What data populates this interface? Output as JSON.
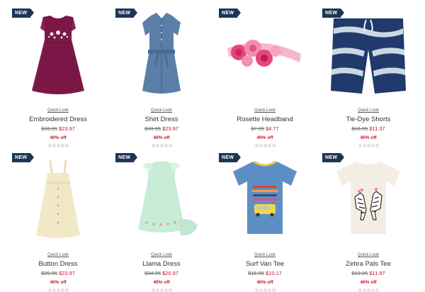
{
  "products": [
    {
      "badge": "NEW",
      "quick_look": "Quick Look",
      "name": "Embroidered Dress",
      "was": "$39.95",
      "now": "$23.97",
      "discount": "40% off",
      "icon": "embroidered-dress-image",
      "rating": 0
    },
    {
      "badge": "NEW",
      "quick_look": "Quick Look",
      "name": "Shirt Dress",
      "was": "$39.95",
      "now": "$23.97",
      "discount": "40% off",
      "icon": "shirt-dress-image",
      "rating": 0
    },
    {
      "badge": "NEW",
      "quick_look": "Quick Look",
      "name": "Rosette Headband",
      "was": "$7.95",
      "now": "$4.77",
      "discount": "40% off",
      "icon": "rosette-headband-image",
      "rating": 0
    },
    {
      "badge": "NEW",
      "quick_look": "Quick Look",
      "name": "Tie-Dye Shorts",
      "was": "$18.95",
      "now": "$11.37",
      "discount": "40% off",
      "icon": "tie-dye-shorts-image",
      "rating": 0
    },
    {
      "badge": "NEW",
      "quick_look": "Quick Look",
      "name": "Button Dress",
      "was": "$39.95",
      "now": "$23.97",
      "discount": "40% off",
      "icon": "button-dress-image",
      "rating": 0
    },
    {
      "badge": "NEW",
      "quick_look": "Quick Look",
      "name": "Llama Dress",
      "was": "$34.95",
      "now": "$20.97",
      "discount": "40% off",
      "icon": "llama-dress-image",
      "rating": 0
    },
    {
      "badge": "NEW",
      "quick_look": "Quick Look",
      "name": "Surf Van Tee",
      "was": "$16.95",
      "now": "$10.17",
      "discount": "40% off",
      "icon": "surf-van-tee-image",
      "rating": 0
    },
    {
      "badge": "NEW",
      "quick_look": "Quick Look",
      "name": "Zebra Pals Tee",
      "was": "$19.95",
      "now": "$11.97",
      "discount": "40% off",
      "icon": "zebra-pals-tee-image",
      "rating": 0
    }
  ],
  "colors": {
    "badge": "#1d3557",
    "sale": "#c8102e",
    "star_empty": "#e2e2e2"
  }
}
